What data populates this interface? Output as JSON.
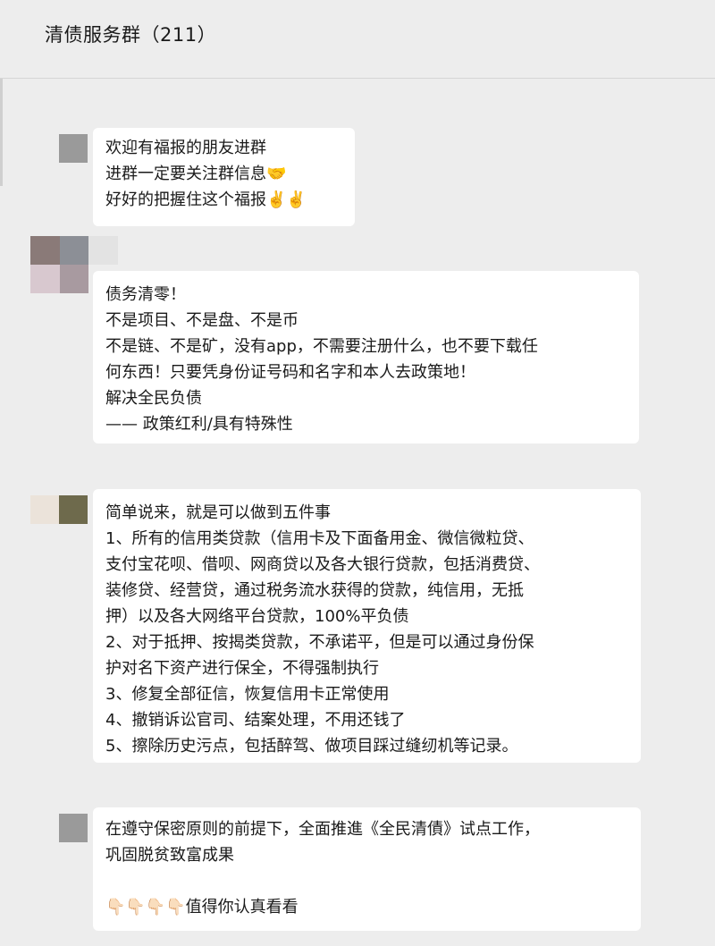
{
  "chat": {
    "title": "清债服务群（211）"
  },
  "messages": [
    {
      "lines": [
        "欢迎有福报的朋友进群",
        "进群一定要关注群信息🤝",
        "好好的把握住这个福报✌️✌️"
      ]
    },
    {
      "lines": [
        "债务清零！",
        "不是项目、不是盘、不是币",
        "不是链、不是矿，没有app，不需要注册什么，也不要下载任",
        "何东西！只要凭身份证号码和名字和本人去政策地！",
        "解决全民负债",
        "—— 政策红利/具有特殊性"
      ]
    },
    {
      "lines": [
        "简单说来，就是可以做到五件事",
        "1、所有的信用类贷款（信用卡及下面备用金、微信微粒贷、",
        "支付宝花呗、借呗、网商贷以及各大银行贷款，包括消费贷、",
        "装修贷、经营贷，通过税务流水获得的贷款，纯信用，无抵",
        "押）以及各大网络平台贷款，100%平负债",
        "2、对于抵押、按揭类贷款，不承诺平，但是可以通过身份保",
        "护对名下资产进行保全，不得强制执行",
        "3、修复全部征信，恢复信用卡正常使用",
        "4、撤销诉讼官司、结案处理，不用还钱了",
        "5、擦除历史污点，包括醉驾、做项目踩过缝纫机等记录。"
      ]
    },
    {
      "lines": [
        "在遵守保密原则的前提下，全面推進《全民清債》试点工作，",
        "巩固脱贫致富成果",
        "",
        "👇🏻👇🏻👇🏻👇🏻值得你认真看看"
      ]
    }
  ],
  "colors": {
    "background": "#ededed",
    "bubble": "#ffffff",
    "text": "#1a1a1a"
  }
}
